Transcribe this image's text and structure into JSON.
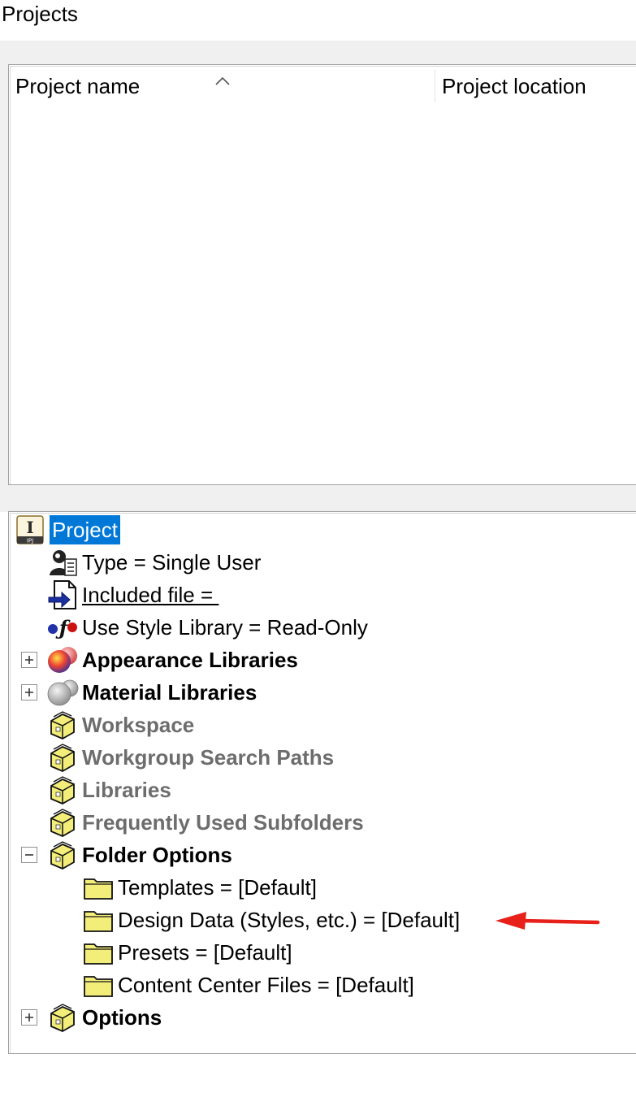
{
  "page": {
    "title": "Projects"
  },
  "project_list": {
    "columns": [
      {
        "label": "Project name",
        "sorted": true
      },
      {
        "label": "Project location"
      }
    ],
    "rows": []
  },
  "tree": {
    "root": {
      "label": "Project",
      "icon": "ipj-file-icon",
      "badge": "IPJ",
      "selected": true
    },
    "type": {
      "label": "Type = Single User",
      "icon": "single-user-icon"
    },
    "included_file": {
      "label": "Included file = ",
      "icon": "included-file-icon"
    },
    "style_library": {
      "label": "Use Style Library = Read-Only",
      "icon": "style-library-icon"
    },
    "appearance_libraries": {
      "label": "Appearance Libraries",
      "icon": "appearance-spheres-icon",
      "expander": "+"
    },
    "material_libraries": {
      "label": "Material Libraries",
      "icon": "material-spheres-icon",
      "expander": "+"
    },
    "workspace": {
      "label": "Workspace",
      "icon": "folder-options-icon"
    },
    "workgroup_search_paths": {
      "label": "Workgroup Search Paths",
      "icon": "folder-options-icon"
    },
    "libraries": {
      "label": "Libraries",
      "icon": "folder-options-icon"
    },
    "frequently_used_subfolders": {
      "label": "Frequently Used Subfolders",
      "icon": "folder-options-icon"
    },
    "folder_options": {
      "label": "Folder Options",
      "icon": "folder-options-icon",
      "expander": "−",
      "children": [
        {
          "label": "Templates = [Default]",
          "icon": "folder-icon"
        },
        {
          "label": "Design Data (Styles, etc.) = [Default]",
          "icon": "folder-icon"
        },
        {
          "label": "Presets = [Default]",
          "icon": "folder-icon"
        },
        {
          "label": "Content Center Files = [Default]",
          "icon": "folder-icon"
        }
      ]
    },
    "options": {
      "label": "Options",
      "icon": "folder-options-icon",
      "expander": "+"
    }
  },
  "colors": {
    "selection": "#0078d7",
    "disabled_text": "#6d6d6d",
    "annotation_arrow": "#e8201a",
    "folder_fill": "#f3ee7a"
  }
}
